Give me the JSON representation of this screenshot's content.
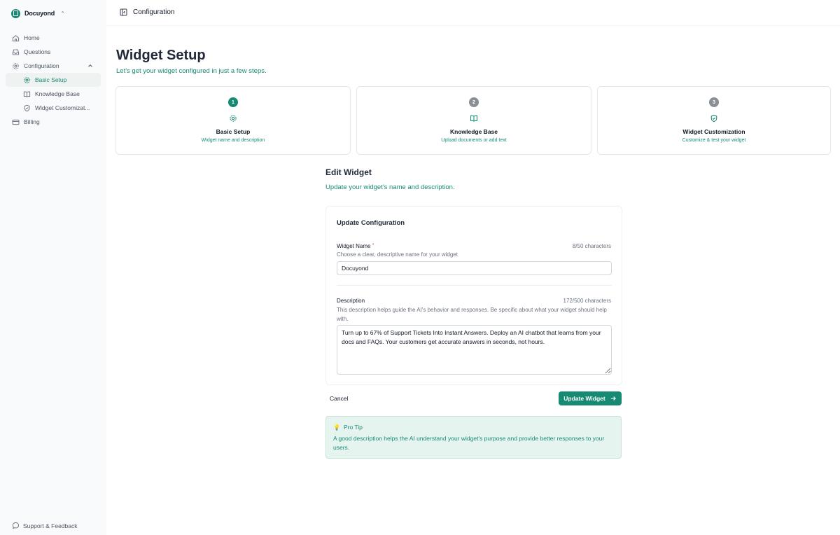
{
  "sidebar": {
    "brand": "Docuyond",
    "items": [
      {
        "label": "Home",
        "icon": "home-icon"
      },
      {
        "label": "Questions",
        "icon": "inbox-icon"
      },
      {
        "label": "Configuration",
        "icon": "gear-icon"
      },
      {
        "label": "Basic Setup",
        "icon": "gear-icon"
      },
      {
        "label": "Knowledge Base",
        "icon": "book-icon"
      },
      {
        "label": "Widget Customizat...",
        "icon": "shield-icon"
      },
      {
        "label": "Billing",
        "icon": "card-icon"
      }
    ],
    "support": "Support & Feedback"
  },
  "topbar": {
    "title": "Configuration"
  },
  "page": {
    "title": "Widget Setup",
    "subtitle": "Let's get your widget configured in just a few steps."
  },
  "steps": [
    {
      "number": "1",
      "title": "Basic Setup",
      "desc": "Widget name and description",
      "icon": "gear-icon"
    },
    {
      "number": "2",
      "title": "Knowledge Base",
      "desc": "Upload documents or add text",
      "icon": "book-icon"
    },
    {
      "number": "3",
      "title": "Widget Customization",
      "desc": "Customize & test your widget",
      "icon": "shield-check-icon"
    }
  ],
  "edit": {
    "title": "Edit Widget",
    "subtitle": "Update your widget's name and description."
  },
  "form": {
    "card_title": "Update Configuration",
    "name_label": "Widget Name",
    "name_required": "*",
    "name_count": "8/50 characters",
    "name_help": "Choose a clear, descriptive name for your widget",
    "name_value": "Docuyond",
    "desc_label": "Description",
    "desc_count": "172/500 characters",
    "desc_help": "This description helps guide the AI's behavior and responses. Be specific about what your widget should help with.",
    "desc_value": "Turn up to 67% of Support Tickets Into Instant Answers. Deploy an AI chatbot that learns from your docs and FAQs. Your customers get accurate answers in seconds, not hours."
  },
  "actions": {
    "cancel": "Cancel",
    "update": "Update Widget"
  },
  "tip": {
    "title": "Pro Tip",
    "text": "A good description helps the AI understand your widget's purpose and provide better responses to your users."
  },
  "colors": {
    "accent": "#178a74",
    "tip_bg": "#e6f4ef",
    "step_inactive": "#8a8f96"
  }
}
